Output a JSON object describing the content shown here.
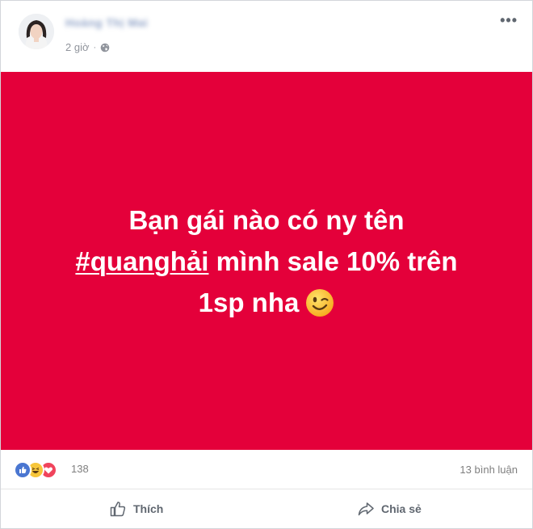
{
  "post": {
    "author_name": "Hoàng Thị Mai",
    "timestamp": "2 giờ",
    "separator": "·",
    "privacy_icon": "globe-icon",
    "menu_icon": "more-icon",
    "status": {
      "line1": "Bạn gái nào có ny tên",
      "hashtag": "#quanghải",
      "line2_rest": " mình sale 10% trên",
      "line3": "1sp nha",
      "emoji": "wink-emoji",
      "background_color": "#e4003a",
      "text_color": "#ffffff"
    },
    "reactions": {
      "icons": [
        "like-icon",
        "haha-icon",
        "love-icon"
      ],
      "count": "138"
    },
    "comments_label": "13 bình luận",
    "actions": {
      "like_label": "Thích",
      "share_label": "Chia sẻ"
    }
  }
}
